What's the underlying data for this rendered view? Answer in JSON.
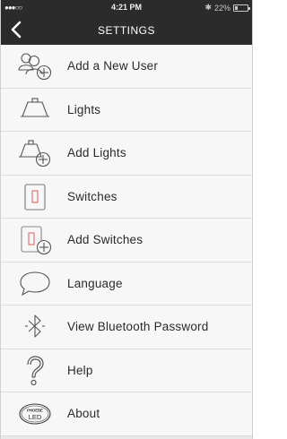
{
  "status_bar": {
    "signal": "●●●○○",
    "time": "4:21 PM",
    "bluetooth": "✱",
    "battery_text": "22%",
    "battery_level": 0.22
  },
  "nav": {
    "title": "SETTINGS",
    "back_icon": "chevron-left-icon"
  },
  "menu": {
    "items": [
      {
        "label": "Add a New User",
        "icon": "add-user-icon"
      },
      {
        "label": "Lights",
        "icon": "light-fixture-icon"
      },
      {
        "label": "Add Lights",
        "icon": "add-light-icon"
      },
      {
        "label": "Switches",
        "icon": "switch-icon"
      },
      {
        "label": "Add Switches",
        "icon": "add-switch-icon"
      },
      {
        "label": "Language",
        "icon": "speech-bubble-icon"
      },
      {
        "label": "View Bluetooth Password",
        "icon": "bluetooth-icon"
      },
      {
        "label": "Help",
        "icon": "question-mark-icon"
      },
      {
        "label": "About",
        "icon": "phoebe-led-logo-icon",
        "logo_text_top": "PHOEBE",
        "logo_text_bottom": "LED"
      }
    ]
  },
  "colors": {
    "bar_background": "#2b2b2b",
    "list_background": "#f7f7f7",
    "switch_accent": "#e06a6a"
  }
}
